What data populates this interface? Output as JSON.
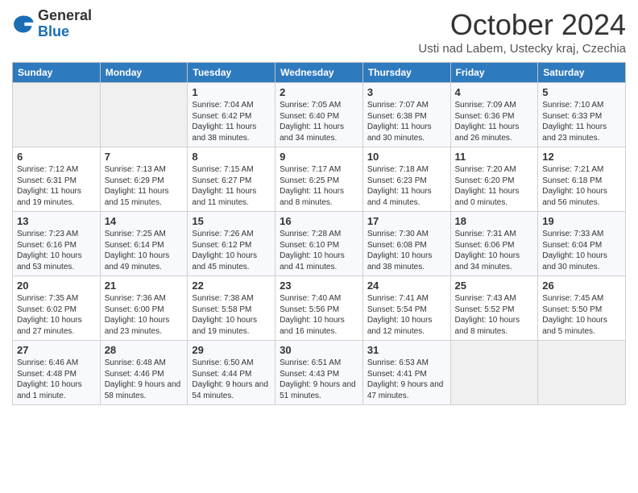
{
  "header": {
    "logo_general": "General",
    "logo_blue": "Blue",
    "month_title": "October 2024",
    "subtitle": "Usti nad Labem, Ustecky kraj, Czechia"
  },
  "days_of_week": [
    "Sunday",
    "Monday",
    "Tuesday",
    "Wednesday",
    "Thursday",
    "Friday",
    "Saturday"
  ],
  "weeks": [
    [
      {
        "day": "",
        "info": ""
      },
      {
        "day": "",
        "info": ""
      },
      {
        "day": "1",
        "info": "Sunrise: 7:04 AM\nSunset: 6:42 PM\nDaylight: 11 hours and 38 minutes."
      },
      {
        "day": "2",
        "info": "Sunrise: 7:05 AM\nSunset: 6:40 PM\nDaylight: 11 hours and 34 minutes."
      },
      {
        "day": "3",
        "info": "Sunrise: 7:07 AM\nSunset: 6:38 PM\nDaylight: 11 hours and 30 minutes."
      },
      {
        "day": "4",
        "info": "Sunrise: 7:09 AM\nSunset: 6:36 PM\nDaylight: 11 hours and 26 minutes."
      },
      {
        "day": "5",
        "info": "Sunrise: 7:10 AM\nSunset: 6:33 PM\nDaylight: 11 hours and 23 minutes."
      }
    ],
    [
      {
        "day": "6",
        "info": "Sunrise: 7:12 AM\nSunset: 6:31 PM\nDaylight: 11 hours and 19 minutes."
      },
      {
        "day": "7",
        "info": "Sunrise: 7:13 AM\nSunset: 6:29 PM\nDaylight: 11 hours and 15 minutes."
      },
      {
        "day": "8",
        "info": "Sunrise: 7:15 AM\nSunset: 6:27 PM\nDaylight: 11 hours and 11 minutes."
      },
      {
        "day": "9",
        "info": "Sunrise: 7:17 AM\nSunset: 6:25 PM\nDaylight: 11 hours and 8 minutes."
      },
      {
        "day": "10",
        "info": "Sunrise: 7:18 AM\nSunset: 6:23 PM\nDaylight: 11 hours and 4 minutes."
      },
      {
        "day": "11",
        "info": "Sunrise: 7:20 AM\nSunset: 6:20 PM\nDaylight: 11 hours and 0 minutes."
      },
      {
        "day": "12",
        "info": "Sunrise: 7:21 AM\nSunset: 6:18 PM\nDaylight: 10 hours and 56 minutes."
      }
    ],
    [
      {
        "day": "13",
        "info": "Sunrise: 7:23 AM\nSunset: 6:16 PM\nDaylight: 10 hours and 53 minutes."
      },
      {
        "day": "14",
        "info": "Sunrise: 7:25 AM\nSunset: 6:14 PM\nDaylight: 10 hours and 49 minutes."
      },
      {
        "day": "15",
        "info": "Sunrise: 7:26 AM\nSunset: 6:12 PM\nDaylight: 10 hours and 45 minutes."
      },
      {
        "day": "16",
        "info": "Sunrise: 7:28 AM\nSunset: 6:10 PM\nDaylight: 10 hours and 41 minutes."
      },
      {
        "day": "17",
        "info": "Sunrise: 7:30 AM\nSunset: 6:08 PM\nDaylight: 10 hours and 38 minutes."
      },
      {
        "day": "18",
        "info": "Sunrise: 7:31 AM\nSunset: 6:06 PM\nDaylight: 10 hours and 34 minutes."
      },
      {
        "day": "19",
        "info": "Sunrise: 7:33 AM\nSunset: 6:04 PM\nDaylight: 10 hours and 30 minutes."
      }
    ],
    [
      {
        "day": "20",
        "info": "Sunrise: 7:35 AM\nSunset: 6:02 PM\nDaylight: 10 hours and 27 minutes."
      },
      {
        "day": "21",
        "info": "Sunrise: 7:36 AM\nSunset: 6:00 PM\nDaylight: 10 hours and 23 minutes."
      },
      {
        "day": "22",
        "info": "Sunrise: 7:38 AM\nSunset: 5:58 PM\nDaylight: 10 hours and 19 minutes."
      },
      {
        "day": "23",
        "info": "Sunrise: 7:40 AM\nSunset: 5:56 PM\nDaylight: 10 hours and 16 minutes."
      },
      {
        "day": "24",
        "info": "Sunrise: 7:41 AM\nSunset: 5:54 PM\nDaylight: 10 hours and 12 minutes."
      },
      {
        "day": "25",
        "info": "Sunrise: 7:43 AM\nSunset: 5:52 PM\nDaylight: 10 hours and 8 minutes."
      },
      {
        "day": "26",
        "info": "Sunrise: 7:45 AM\nSunset: 5:50 PM\nDaylight: 10 hours and 5 minutes."
      }
    ],
    [
      {
        "day": "27",
        "info": "Sunrise: 6:46 AM\nSunset: 4:48 PM\nDaylight: 10 hours and 1 minute."
      },
      {
        "day": "28",
        "info": "Sunrise: 6:48 AM\nSunset: 4:46 PM\nDaylight: 9 hours and 58 minutes."
      },
      {
        "day": "29",
        "info": "Sunrise: 6:50 AM\nSunset: 4:44 PM\nDaylight: 9 hours and 54 minutes."
      },
      {
        "day": "30",
        "info": "Sunrise: 6:51 AM\nSunset: 4:43 PM\nDaylight: 9 hours and 51 minutes."
      },
      {
        "day": "31",
        "info": "Sunrise: 6:53 AM\nSunset: 4:41 PM\nDaylight: 9 hours and 47 minutes."
      },
      {
        "day": "",
        "info": ""
      },
      {
        "day": "",
        "info": ""
      }
    ]
  ]
}
